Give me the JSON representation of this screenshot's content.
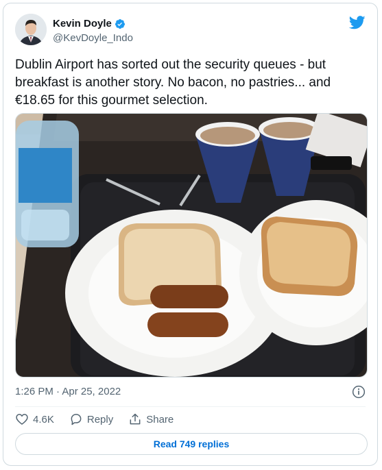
{
  "author": {
    "display_name": "Kevin Doyle",
    "handle": "@KevDoyle_Indo",
    "verified": true
  },
  "tweet": {
    "lines": [
      "Dublin Airport has sorted out the security queues - but",
      "breakfast is another story. No bacon, no pastries... and",
      "€18.65 for this gourmet selection."
    ],
    "timestamp": "1:26 PM · Apr 25, 2022"
  },
  "actions": {
    "likes": "4.6K",
    "reply_label": "Reply",
    "share_label": "Share"
  },
  "read_replies_label": "Read 749 replies",
  "colors": {
    "accent": "#1d9bf0",
    "link": "#006fd6",
    "muted": "#536471",
    "border": "#cfd9de"
  },
  "icons": [
    "verified-badge-icon",
    "twitter-bird-icon",
    "info-icon",
    "heart-icon",
    "reply-icon",
    "share-icon"
  ]
}
